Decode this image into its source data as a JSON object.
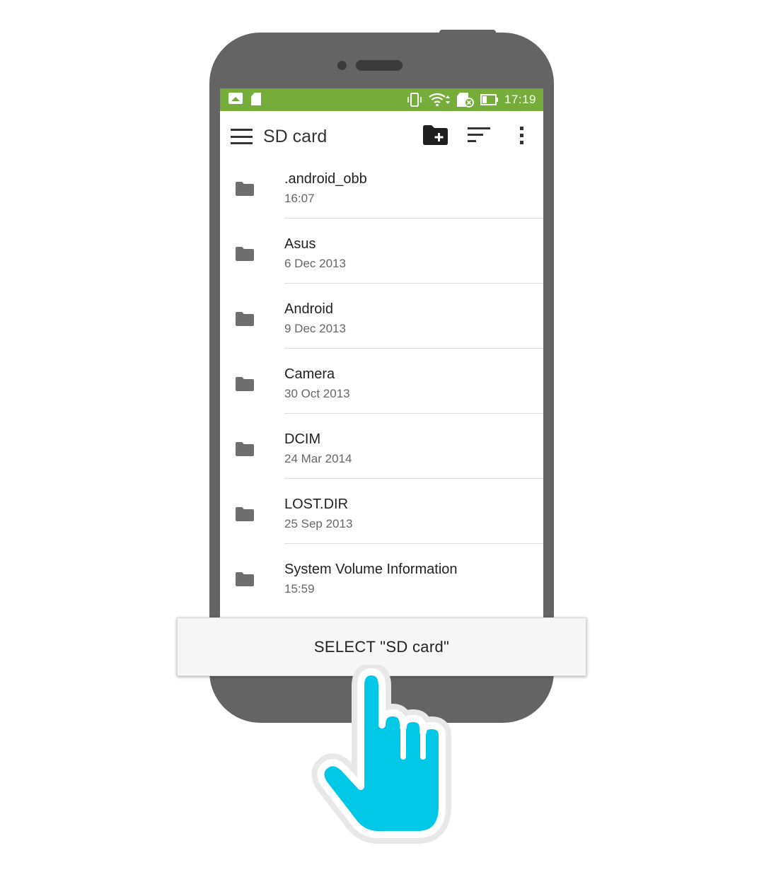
{
  "status_bar": {
    "time": "17:19",
    "background": "#76ad3a",
    "left_icons": [
      "image-icon",
      "sd-card-icon"
    ],
    "right_icons": [
      "vibrate-icon",
      "wifi-icon",
      "sd-card-error-icon",
      "battery-icon"
    ]
  },
  "toolbar": {
    "title": "SD card",
    "actions": [
      "new-folder-icon",
      "sort-icon",
      "more-options-icon"
    ]
  },
  "files": [
    {
      "name": ".android_obb",
      "date": "16:07"
    },
    {
      "name": "Asus",
      "date": "6 Dec 2013"
    },
    {
      "name": "Android",
      "date": "9 Dec 2013"
    },
    {
      "name": "Camera",
      "date": "30 Oct 2013"
    },
    {
      "name": "DCIM",
      "date": "24 Mar 2014"
    },
    {
      "name": "LOST.DIR",
      "date": "25 Sep 2013"
    },
    {
      "name": "System Volume Information",
      "date": "15:59"
    }
  ],
  "select_button": {
    "label": "SELECT \"SD card\""
  },
  "colors": {
    "phone_body": "#646464",
    "status_bar": "#76ad3a",
    "pointer_hand": "#00c8e6"
  }
}
